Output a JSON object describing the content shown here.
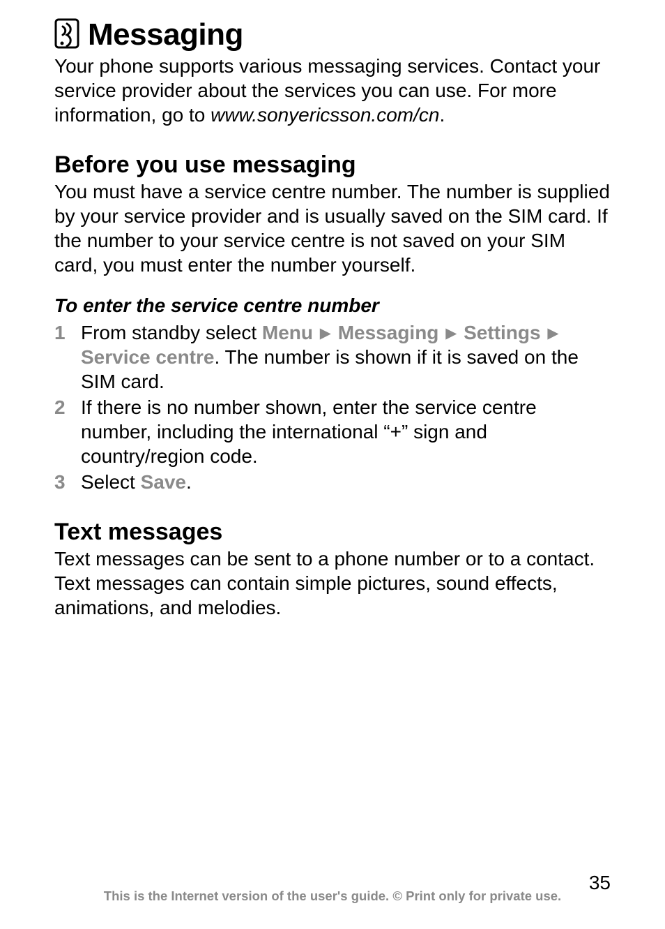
{
  "heading": {
    "title": "Messaging",
    "icon": "messaging-icon",
    "intro_line1": "Your phone supports various messaging services. Contact your service provider about the services you can use. For more information, go to ",
    "intro_url": "www.sonyericsson.com/cn",
    "intro_suffix": "."
  },
  "section_before": {
    "title": "Before you use messaging",
    "body": "You must have a service centre number. The number is supplied by your service provider and is usually saved on the SIM card. If the number to your service centre is not saved on your SIM card, you must enter the number yourself.",
    "subhead": "To enter the service centre number",
    "steps": [
      {
        "num": "1",
        "prefix": "From standby select ",
        "path": [
          "Menu",
          "Messaging",
          "Settings",
          "Service centre"
        ],
        "suffix": ". The number is shown if it is saved on the SIM card."
      },
      {
        "num": "2",
        "text": "If there is no number shown, enter the service centre number, including the international “+” sign and country/region code."
      },
      {
        "num": "3",
        "prefix": "Select ",
        "menu": "Save",
        "suffix": "."
      }
    ]
  },
  "section_text_messages": {
    "title": "Text messages",
    "body": "Text messages can be sent to a phone number or to a contact. Text messages can contain simple pictures, sound effects, animations, and melodies."
  },
  "footer": {
    "page_number": "35",
    "text": "This is the Internet version of the user's guide. © Print only for private use."
  }
}
